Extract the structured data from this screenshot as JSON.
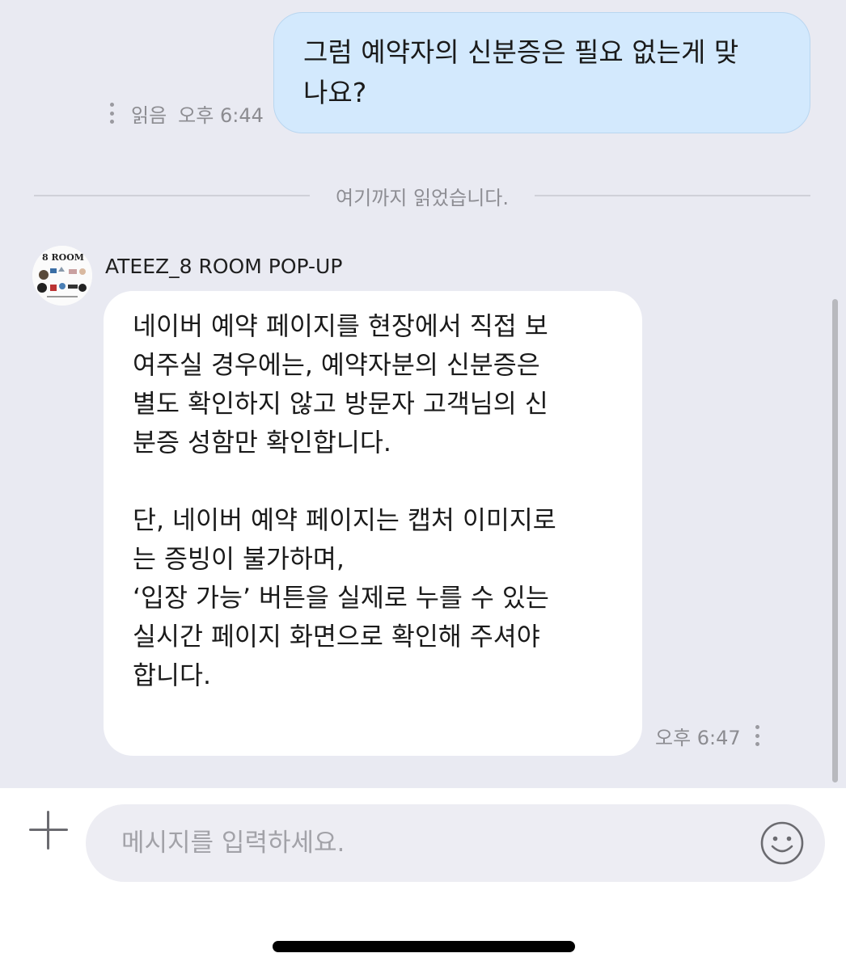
{
  "sent_message": {
    "text": "그럼 예약자의 신분증은 필요 없는게 맞\n나요?",
    "read_status": "읽음",
    "time": "오후 6:44"
  },
  "divider": {
    "text": "여기까지 읽었습니다."
  },
  "received_message": {
    "sender": "ATEEZ_8 ROOM POP-UP",
    "avatar_text": "8 ROOM",
    "text": "네이버 예약 페이지를 현장에서 직접 보\n여주실 경우에는, 예약자분의 신분증은\n별도 확인하지 않고 방문자 고객님의 신\n분증 성함만 확인합니다.\n\n단, 네이버 예약 페이지는 캡처 이미지로\n는 증빙이 불가하며,\n‘입장 가능’ 버튼을 실제로 누를 수 있는\n실시간 페이지 화면으로 확인해 주셔야\n합니다.",
    "time": "오후 6:47"
  },
  "input_bar": {
    "placeholder": "메시지를 입력하세요.",
    "value": ""
  },
  "icons": {
    "add": "plus-icon",
    "emoji": "smiley-icon",
    "more": "more-vertical-icon"
  },
  "colors": {
    "chat_background": "#e9eaf2",
    "sent_bubble": "#d3e9fd",
    "received_bubble": "#ffffff",
    "input_field": "#ededf3"
  }
}
